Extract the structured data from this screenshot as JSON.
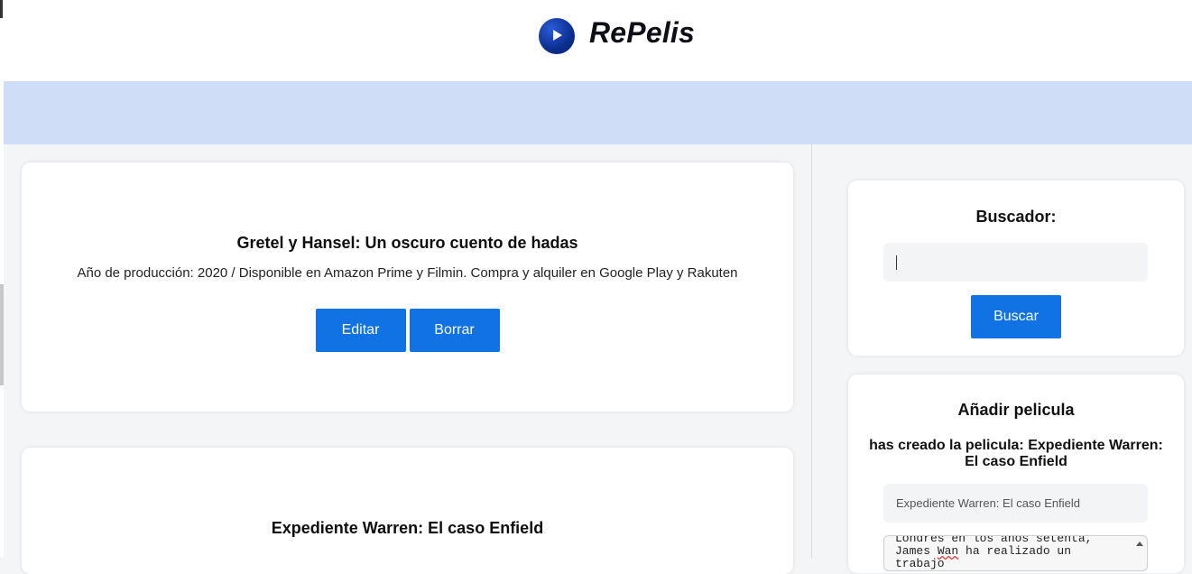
{
  "header": {
    "brand": "RePelis",
    "logo_icon": "play-circle-icon"
  },
  "movies": [
    {
      "title": "Gretel y Hansel: Un oscuro cuento de hadas",
      "description": "Año de producción: 2020 / Disponible en Amazon Prime y Filmin. Compra y alquiler en Google Play y Rakuten",
      "edit_label": "Editar",
      "delete_label": "Borrar"
    },
    {
      "title": "Expediente Warren: El caso Enfield"
    }
  ],
  "search": {
    "title": "Buscador:",
    "value": "",
    "button_label": "Buscar"
  },
  "add_movie": {
    "title": "Añadir pelicula",
    "created_message": "has creado la pelicula: Expediente Warren: El caso Enfield",
    "title_field_value": "Expediente Warren: El caso Enfield",
    "textarea_line_1": "Londres en los años setenta,",
    "textarea_line_2_pre": "James ",
    "textarea_line_2_word": "Wan",
    "textarea_line_2_post": " ha realizado un trabajo"
  },
  "colors": {
    "accent": "#1072e3",
    "nav_band": "#d0ddf6",
    "logo": "#0b2e8f"
  }
}
